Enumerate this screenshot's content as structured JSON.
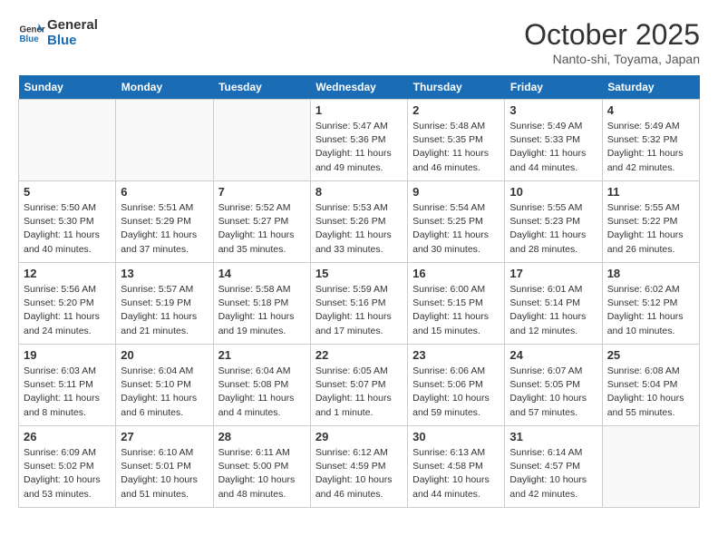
{
  "header": {
    "logo_line1": "General",
    "logo_line2": "Blue",
    "month": "October 2025",
    "location": "Nanto-shi, Toyama, Japan"
  },
  "days_of_week": [
    "Sunday",
    "Monday",
    "Tuesday",
    "Wednesday",
    "Thursday",
    "Friday",
    "Saturday"
  ],
  "weeks": [
    [
      {
        "day": "",
        "info": ""
      },
      {
        "day": "",
        "info": ""
      },
      {
        "day": "",
        "info": ""
      },
      {
        "day": "1",
        "info": "Sunrise: 5:47 AM\nSunset: 5:36 PM\nDaylight: 11 hours and 49 minutes."
      },
      {
        "day": "2",
        "info": "Sunrise: 5:48 AM\nSunset: 5:35 PM\nDaylight: 11 hours and 46 minutes."
      },
      {
        "day": "3",
        "info": "Sunrise: 5:49 AM\nSunset: 5:33 PM\nDaylight: 11 hours and 44 minutes."
      },
      {
        "day": "4",
        "info": "Sunrise: 5:49 AM\nSunset: 5:32 PM\nDaylight: 11 hours and 42 minutes."
      }
    ],
    [
      {
        "day": "5",
        "info": "Sunrise: 5:50 AM\nSunset: 5:30 PM\nDaylight: 11 hours and 40 minutes."
      },
      {
        "day": "6",
        "info": "Sunrise: 5:51 AM\nSunset: 5:29 PM\nDaylight: 11 hours and 37 minutes."
      },
      {
        "day": "7",
        "info": "Sunrise: 5:52 AM\nSunset: 5:27 PM\nDaylight: 11 hours and 35 minutes."
      },
      {
        "day": "8",
        "info": "Sunrise: 5:53 AM\nSunset: 5:26 PM\nDaylight: 11 hours and 33 minutes."
      },
      {
        "day": "9",
        "info": "Sunrise: 5:54 AM\nSunset: 5:25 PM\nDaylight: 11 hours and 30 minutes."
      },
      {
        "day": "10",
        "info": "Sunrise: 5:55 AM\nSunset: 5:23 PM\nDaylight: 11 hours and 28 minutes."
      },
      {
        "day": "11",
        "info": "Sunrise: 5:55 AM\nSunset: 5:22 PM\nDaylight: 11 hours and 26 minutes."
      }
    ],
    [
      {
        "day": "12",
        "info": "Sunrise: 5:56 AM\nSunset: 5:20 PM\nDaylight: 11 hours and 24 minutes."
      },
      {
        "day": "13",
        "info": "Sunrise: 5:57 AM\nSunset: 5:19 PM\nDaylight: 11 hours and 21 minutes."
      },
      {
        "day": "14",
        "info": "Sunrise: 5:58 AM\nSunset: 5:18 PM\nDaylight: 11 hours and 19 minutes."
      },
      {
        "day": "15",
        "info": "Sunrise: 5:59 AM\nSunset: 5:16 PM\nDaylight: 11 hours and 17 minutes."
      },
      {
        "day": "16",
        "info": "Sunrise: 6:00 AM\nSunset: 5:15 PM\nDaylight: 11 hours and 15 minutes."
      },
      {
        "day": "17",
        "info": "Sunrise: 6:01 AM\nSunset: 5:14 PM\nDaylight: 11 hours and 12 minutes."
      },
      {
        "day": "18",
        "info": "Sunrise: 6:02 AM\nSunset: 5:12 PM\nDaylight: 11 hours and 10 minutes."
      }
    ],
    [
      {
        "day": "19",
        "info": "Sunrise: 6:03 AM\nSunset: 5:11 PM\nDaylight: 11 hours and 8 minutes."
      },
      {
        "day": "20",
        "info": "Sunrise: 6:04 AM\nSunset: 5:10 PM\nDaylight: 11 hours and 6 minutes."
      },
      {
        "day": "21",
        "info": "Sunrise: 6:04 AM\nSunset: 5:08 PM\nDaylight: 11 hours and 4 minutes."
      },
      {
        "day": "22",
        "info": "Sunrise: 6:05 AM\nSunset: 5:07 PM\nDaylight: 11 hours and 1 minute."
      },
      {
        "day": "23",
        "info": "Sunrise: 6:06 AM\nSunset: 5:06 PM\nDaylight: 10 hours and 59 minutes."
      },
      {
        "day": "24",
        "info": "Sunrise: 6:07 AM\nSunset: 5:05 PM\nDaylight: 10 hours and 57 minutes."
      },
      {
        "day": "25",
        "info": "Sunrise: 6:08 AM\nSunset: 5:04 PM\nDaylight: 10 hours and 55 minutes."
      }
    ],
    [
      {
        "day": "26",
        "info": "Sunrise: 6:09 AM\nSunset: 5:02 PM\nDaylight: 10 hours and 53 minutes."
      },
      {
        "day": "27",
        "info": "Sunrise: 6:10 AM\nSunset: 5:01 PM\nDaylight: 10 hours and 51 minutes."
      },
      {
        "day": "28",
        "info": "Sunrise: 6:11 AM\nSunset: 5:00 PM\nDaylight: 10 hours and 48 minutes."
      },
      {
        "day": "29",
        "info": "Sunrise: 6:12 AM\nSunset: 4:59 PM\nDaylight: 10 hours and 46 minutes."
      },
      {
        "day": "30",
        "info": "Sunrise: 6:13 AM\nSunset: 4:58 PM\nDaylight: 10 hours and 44 minutes."
      },
      {
        "day": "31",
        "info": "Sunrise: 6:14 AM\nSunset: 4:57 PM\nDaylight: 10 hours and 42 minutes."
      },
      {
        "day": "",
        "info": ""
      }
    ]
  ]
}
